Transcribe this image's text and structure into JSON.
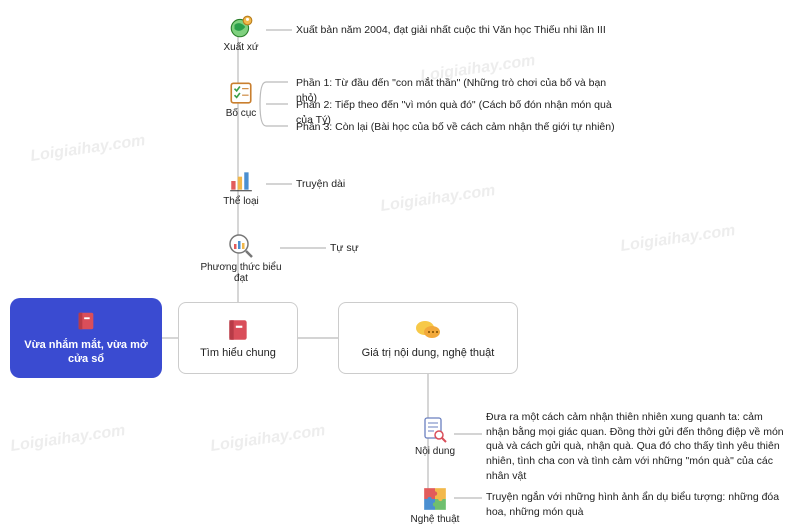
{
  "root": {
    "title": "Vừa nhắm mắt, vừa mở cửa sổ",
    "icon": "book-icon"
  },
  "general": {
    "label": "Tìm hiểu chung",
    "icon": "book-icon"
  },
  "value": {
    "label": "Giá trị nội dung, nghệ thuật",
    "icon": "chat-icon"
  },
  "origin": {
    "caption": "Xuất xứ",
    "text": "Xuất bản năm 2004, đạt giải nhất cuộc thi Văn học Thiếu nhi lần III",
    "icon": "globe-icon"
  },
  "layout": {
    "caption": "Bố cục",
    "p1": "Phần 1: Từ đầu đến \"con mắt thần\" (Những trò chơi của bố và bạn nhỏ)",
    "p2": "Phần 2: Tiếp theo đến \"vì món quà đó\" (Cách bố đón nhận món quà của Tý)",
    "p3": "Phần 3: Còn lại (Bài học của bố về cách cảm nhận thế giới tự nhiên)",
    "icon": "checklist-icon"
  },
  "genre": {
    "caption": "Thể loại",
    "text": "Truyện dài",
    "icon": "bar-chart-icon"
  },
  "mode": {
    "caption": "Phương thức biểu đạt",
    "text": "Tự sự",
    "icon": "magnify-chart-icon"
  },
  "content": {
    "caption": "Nội dung",
    "text": "Đưa ra một cách cảm nhận thiên nhiên xung quanh ta: cảm nhận bằng mọi giác quan. Đồng thời gửi đến thông điệp về món quà và cách gửi quà, nhận quà. Qua đó cho thấy tình yêu thiên nhiên, tình cha con và tình cảm với những \"món quà\" của các nhân vật",
    "icon": "doc-search-icon"
  },
  "art": {
    "caption": "Nghệ thuật",
    "text": "Truyện ngắn với những hình ảnh ẩn dụ biểu tượng: những đóa hoa, những món quà",
    "icon": "puzzle-icon"
  },
  "watermarks": [
    "Loigiaihay.com",
    "Loigiaihay.com",
    "Loigiaihay.com",
    "Loigiaihay.com",
    "Loigiaihay.com",
    "Loigiaihay.com"
  ]
}
